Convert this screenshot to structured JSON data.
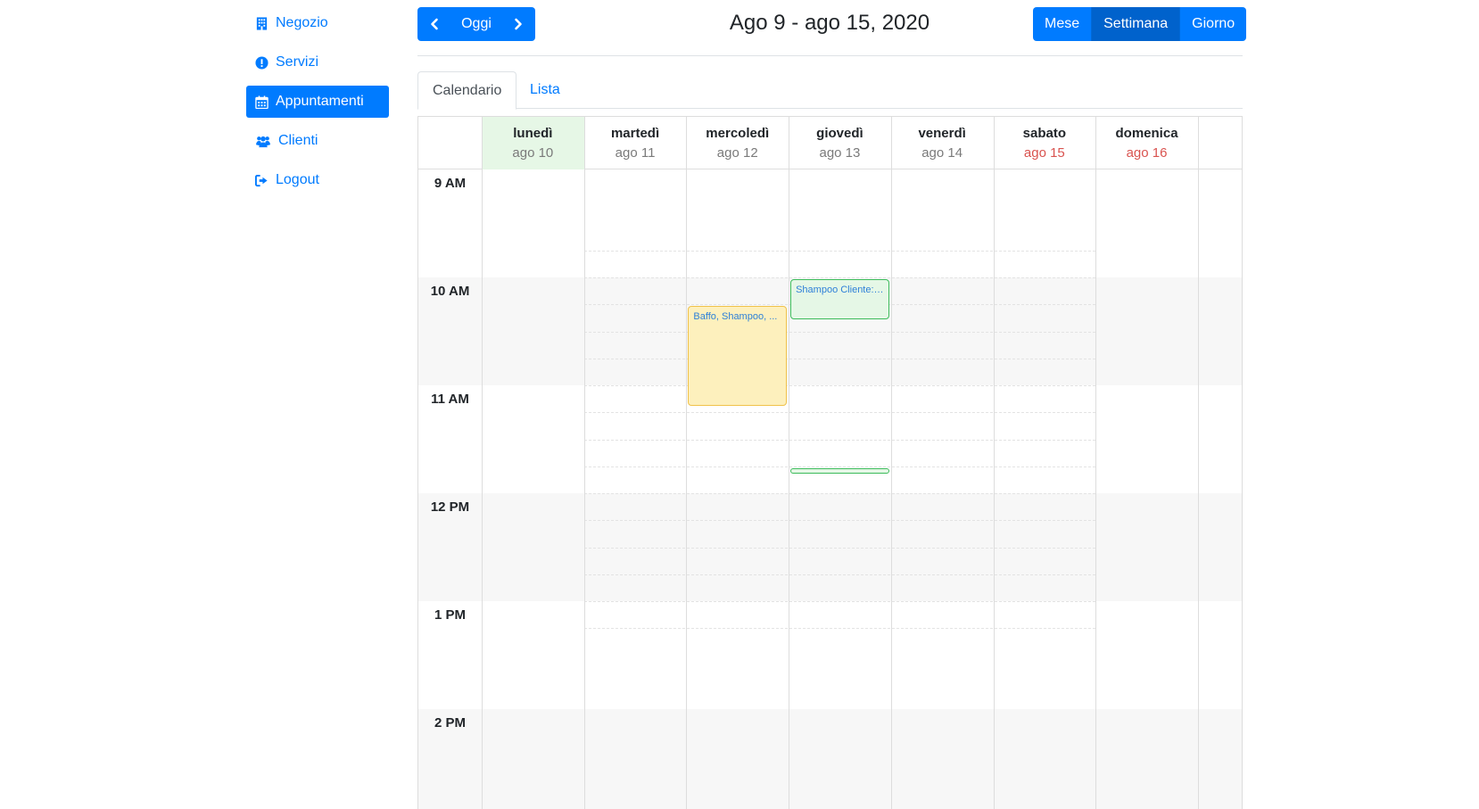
{
  "sidebar": {
    "items": [
      {
        "label": "Negozio",
        "icon": "building-icon"
      },
      {
        "label": "Servizi",
        "icon": "exclamation-circle-icon"
      },
      {
        "label": "Appuntamenti",
        "icon": "calendar-icon",
        "active": true
      },
      {
        "label": "Clienti",
        "icon": "users-icon"
      },
      {
        "label": "Logout",
        "icon": "sign-out-icon"
      }
    ]
  },
  "toolbar": {
    "today_label": "Oggi",
    "title": "Ago 9 - ago 15, 2020",
    "views": [
      "Mese",
      "Settimana",
      "Giorno"
    ],
    "active_view": "Settimana"
  },
  "tabs": {
    "calendar_label": "Calendario",
    "list_label": "Lista"
  },
  "calendar": {
    "days": [
      {
        "name": "lunedì",
        "date": "ago 10",
        "today": true
      },
      {
        "name": "martedì",
        "date": "ago 11"
      },
      {
        "name": "mercoledì",
        "date": "ago 12"
      },
      {
        "name": "giovedì",
        "date": "ago 13"
      },
      {
        "name": "venerdì",
        "date": "ago 14"
      },
      {
        "name": "sabato",
        "date": "ago 15",
        "weekend": true
      },
      {
        "name": "domenica",
        "date": "ago 16",
        "weekend": true
      }
    ],
    "hours": [
      "9 AM",
      "10 AM",
      "11 AM",
      "12 PM",
      "1 PM",
      "2 PM"
    ],
    "events": [
      {
        "title": "Shampoo Cliente: ...",
        "color": "green"
      },
      {
        "title": "Baffo, Shampoo, ...",
        "color": "yellow"
      }
    ]
  },
  "colors": {
    "accent": "#007bff",
    "today_bg": "#e6f7e6",
    "weekend_text": "#d9534f",
    "event_yellow": "#fdf0bd",
    "event_green": "#e5f7e6"
  }
}
